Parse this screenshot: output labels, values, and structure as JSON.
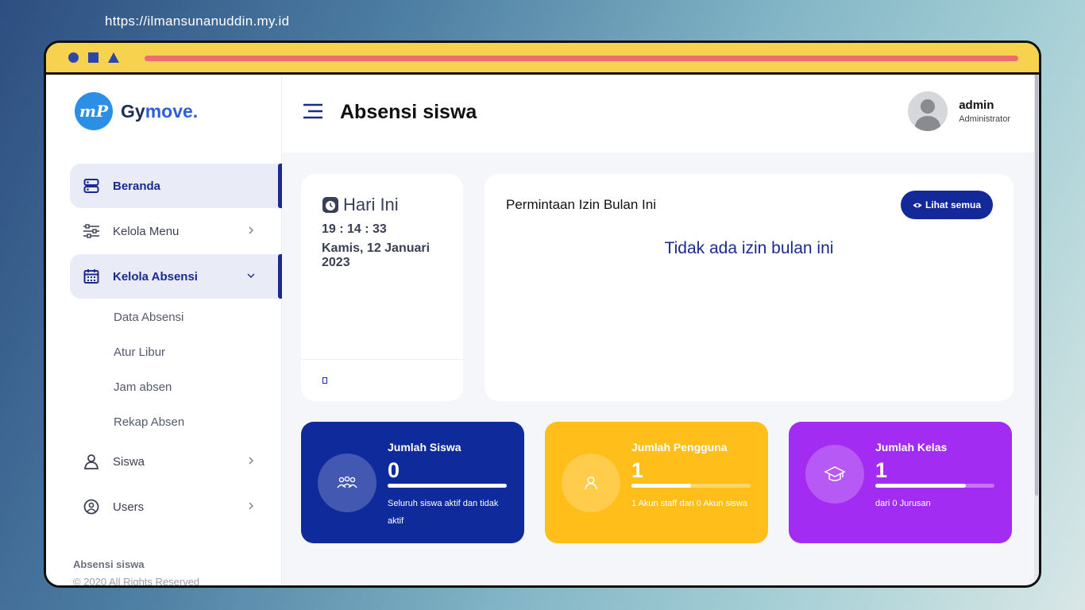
{
  "url": "https://ilmansunanuddin.my.id",
  "brand": {
    "logo": "mP",
    "name_main": "Gy",
    "name_accent": "move."
  },
  "sidebar": {
    "items": [
      {
        "label": "Beranda",
        "icon": "dashboard-icon"
      },
      {
        "label": "Kelola Menu",
        "icon": "sliders-icon"
      },
      {
        "label": "Kelola Absensi",
        "icon": "calendar-icon"
      },
      {
        "label": "Siswa",
        "icon": "student-icon"
      },
      {
        "label": "Users",
        "icon": "users-icon"
      }
    ],
    "subitems": [
      "Data Absensi",
      "Atur Libur",
      "Jam absen",
      "Rekap Absen"
    ],
    "footer_title": "Absensi siswa",
    "footer_copy": "© 2020 All Rights Reserved"
  },
  "header": {
    "title": "Absensi siswa",
    "user_name": "admin",
    "user_role": "Administrator"
  },
  "today": {
    "title": "Hari Ini",
    "time": "19 : 14 : 33",
    "date": "Kamis, 12 Januari 2023"
  },
  "izin": {
    "title": "Permintaan Izin Bulan Ini",
    "button": "Lihat semua",
    "empty": "Tidak ada izin bulan ini"
  },
  "stats": [
    {
      "label": "Jumlah Siswa",
      "value": "0",
      "progress": 1.0,
      "desc": "Seluruh siswa aktif dan tidak aktif",
      "color": "#0f2a9a"
    },
    {
      "label": "Jumlah Pengguna",
      "value": "1",
      "progress": 0.5,
      "desc": "1 Akun staff dan 0 Akun siswa",
      "color": "#ffbe1a"
    },
    {
      "label": "Jumlah Kelas",
      "value": "1",
      "progress": 0.76,
      "desc": "dari 0 Jurusan",
      "color": "#a32cf2"
    }
  ],
  "colors": {
    "primary": "#1b2a8f",
    "topbar": "#f7d24f",
    "topbar_line": "#ef6b6e"
  }
}
